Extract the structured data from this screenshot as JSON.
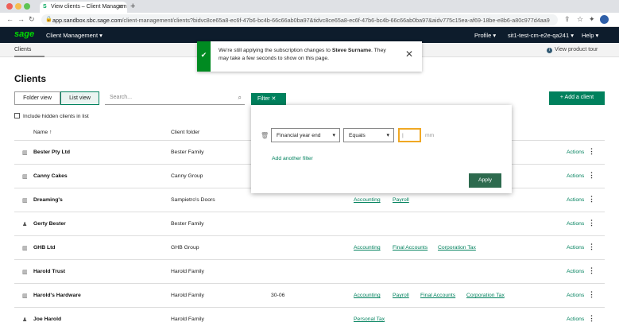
{
  "browser": {
    "tab_title": "View clients – Client Managem",
    "url_host": "app.sandbox.sbc.sage.com",
    "url_path": "/client-management/clients?bidvc8ce65a8-ec6f-47b6-bc4b-66c66ab0ba97&tidvc8ce65a8-ec6f-47b6-bc4b-66c66ab0ba97&aidv775c15ea-af69-18be-e8b6-a80c977d4aa9"
  },
  "topnav": {
    "logo": "sage",
    "app_menu": "Client Management ▾",
    "profile": "Profile ▾",
    "tenant": "sit1-test-cm-e2e-qa241 ▾",
    "help": "Help ▾"
  },
  "subbar": {
    "clients_tab": "Clients",
    "tour_link": "View product tour"
  },
  "toast": {
    "check_icon": "✔",
    "text_before": "We're still applying the subscription changes to ",
    "name": "Steve Surname",
    "text_after": ". They may take a few seconds to show on this page.",
    "close": "✕"
  },
  "main": {
    "title": "Clients",
    "folder_view": "Folder view",
    "list_view": "List view",
    "search_placeholder": "Search...",
    "filter_label": "Filter ✕",
    "add_client": "+ Add a client",
    "include_hidden": "Include hidden clients in list",
    "col_name": "Name ↑",
    "col_folder": "Client folder"
  },
  "filter_panel": {
    "field": "Financial year end",
    "operator": "Equals",
    "value": "|",
    "value_suffix": "mm",
    "add_filter": "Add another filter",
    "apply": "Apply"
  },
  "rows": [
    {
      "name": "Bester Pty Ltd",
      "icon": "building-icon",
      "folder": "Bester Family",
      "ye": "",
      "links": [],
      "action": "Actions"
    },
    {
      "name": "Canny Cakes",
      "icon": "building-icon",
      "folder": "Canny Group",
      "ye": "",
      "links": [],
      "action": "Actions"
    },
    {
      "name": "Dreaming's",
      "icon": "building-icon",
      "folder": "Sampietro's Doors",
      "ye": "",
      "links": [
        "Accounting",
        "Payroll"
      ],
      "action": "Actions"
    },
    {
      "name": "Gerty Bester",
      "icon": "person-icon",
      "folder": "Bester Family",
      "ye": "",
      "links": [],
      "action": "Actions"
    },
    {
      "name": "GHB Ltd",
      "icon": "building-icon",
      "folder": "GHB Group",
      "ye": "",
      "links": [
        "Accounting",
        "Final Accounts",
        "Corporation Tax"
      ],
      "action": "Actions"
    },
    {
      "name": "Harold Trust",
      "icon": "building-icon",
      "folder": "Harold Family",
      "ye": "",
      "links": [],
      "action": "Actions"
    },
    {
      "name": "Harold's Hardware",
      "icon": "building-icon",
      "folder": "Harold Family",
      "ye": "30-06",
      "links": [
        "Accounting",
        "Payroll",
        "Final Accounts",
        "Corporation Tax"
      ],
      "action": "Actions"
    },
    {
      "name": "Joe Harold",
      "icon": "person-icon",
      "folder": "Harold Family",
      "ye": "",
      "links": [
        "Personal Tax"
      ],
      "action": "Actions"
    }
  ]
}
